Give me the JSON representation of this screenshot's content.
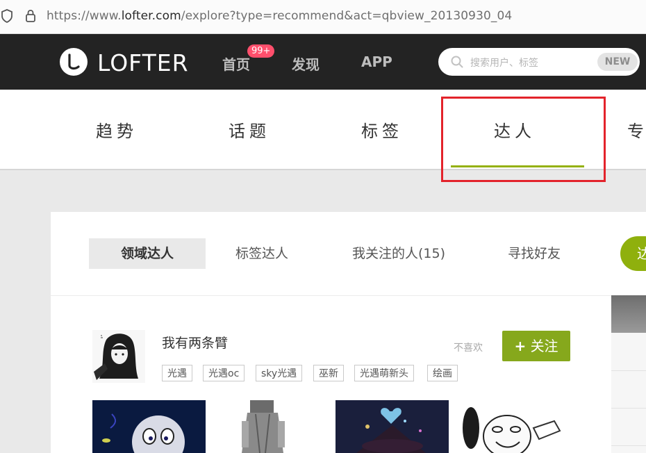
{
  "browser": {
    "url_prefix": "https://www.",
    "url_domain": "lofter.com",
    "url_path": "/explore?type=recommend&act=qbview_20130930_04"
  },
  "topnav": {
    "logo_text": "LOFTER",
    "links": [
      {
        "label": "首页"
      },
      {
        "label": "发现"
      },
      {
        "label": "APP"
      }
    ],
    "badge": "99+",
    "search_placeholder": "搜索用户、标签",
    "search_new": "NEW"
  },
  "categories": [
    {
      "label": "趋势"
    },
    {
      "label": "话题"
    },
    {
      "label": "标签"
    },
    {
      "label": "达人"
    },
    {
      "label": "专"
    }
  ],
  "subtabs": [
    {
      "label": "领域达人"
    },
    {
      "label": "标签达人"
    },
    {
      "label": "我关注的人(15)"
    },
    {
      "label": "寻找好友"
    },
    {
      "label": "达"
    }
  ],
  "user": {
    "name": "我有两条臂",
    "dislike": "不喜欢",
    "follow": "关注",
    "tags": [
      "光遇",
      "光遇oc",
      "sky光遇",
      "巫新",
      "光遇萌新头",
      "绘画"
    ]
  },
  "colors": {
    "accent_green": "#86a81c",
    "badge_red": "#ff4f6c",
    "annotation_red": "#e3232b",
    "nav_bg": "#232323"
  },
  "icons": [
    "shield-icon",
    "lock-icon",
    "search-icon",
    "plus-icon",
    "logo-icon"
  ]
}
